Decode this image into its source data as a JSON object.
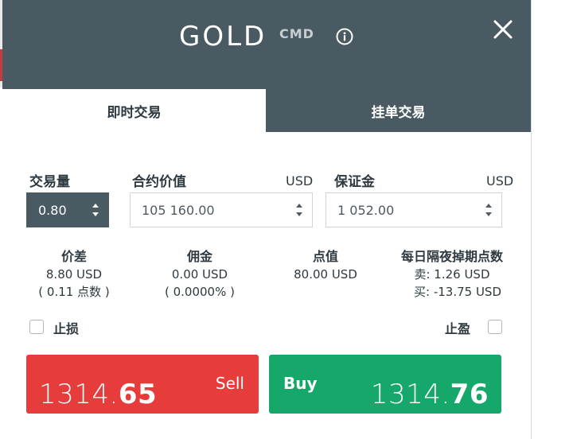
{
  "dialog": {
    "title": "GOLD",
    "tag": "CMD",
    "icons": {
      "info": "info-icon",
      "close": "close-icon"
    }
  },
  "tabs": [
    {
      "label": "即时交易",
      "active": true
    },
    {
      "label": "挂单交易",
      "active": false
    }
  ],
  "form": {
    "quantity": {
      "label": "交易量",
      "value": "0.80"
    },
    "contract_value": {
      "label": "合约价值",
      "unit": "USD",
      "value": "105 160.00"
    },
    "margin": {
      "label": "保证金",
      "unit": "USD",
      "value": "1 052.00"
    }
  },
  "info": {
    "spread": {
      "title": "价差",
      "line1": "8.80 USD",
      "line2": "( 0.11 点数 )"
    },
    "commission": {
      "title": "佣金",
      "line1": "0.00 USD",
      "line2": "( 0.0000% )"
    },
    "pip_value": {
      "title": "点值",
      "line1": "80.00 USD"
    },
    "swap": {
      "title": "每日隔夜掉期点数",
      "sell": "卖: 1.26 USD",
      "buy": "买: -13.75 USD"
    }
  },
  "options": {
    "stop_loss": {
      "label": "止损",
      "checked": false
    },
    "take_profit": {
      "label": "止盈",
      "checked": false
    }
  },
  "trade": {
    "sell": {
      "label": "Sell",
      "price_main": "1314.",
      "price_big": "65",
      "color": "#e63c3c"
    },
    "buy": {
      "label": "Buy",
      "price_main": "1314.",
      "price_big": "76",
      "color": "#16a86b"
    }
  },
  "colors": {
    "header": "#4a5a62",
    "sell": "#e63c3c",
    "buy": "#16a86b"
  }
}
